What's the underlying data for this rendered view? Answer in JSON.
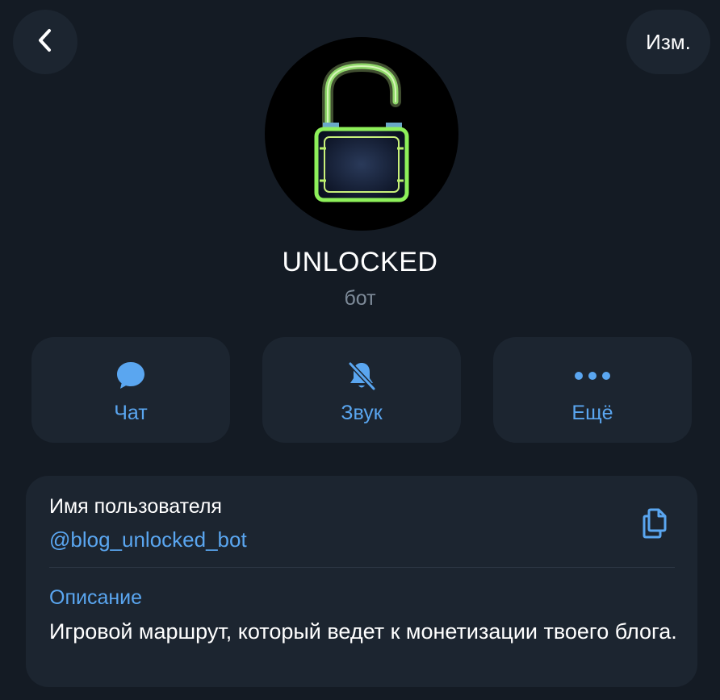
{
  "header": {
    "back_icon": "chevron-left-icon",
    "edit_label": "Изм."
  },
  "profile": {
    "avatar_icon": "unlocked-padlock-icon",
    "name": "UNLOCKED",
    "subtitle": "бот"
  },
  "actions": [
    {
      "label": "Чат",
      "icon": "chat-bubble-icon"
    },
    {
      "label": "Звук",
      "icon": "bell-slash-icon"
    },
    {
      "label": "Ещё",
      "icon": "more-dots-icon"
    }
  ],
  "info": {
    "username_label": "Имя пользователя",
    "username_value": "@blog_unlocked_bot",
    "copy_icon": "copy-icon",
    "description_label": "Описание",
    "description_text": "Игровой маршрут, который ведет к монетизации твоего блога."
  },
  "colors": {
    "background": "#141b24",
    "surface": "#1c2530",
    "accent": "#5aa6f0",
    "secondary_text": "#7d8a98",
    "lock_glow": "#7cf05a"
  }
}
